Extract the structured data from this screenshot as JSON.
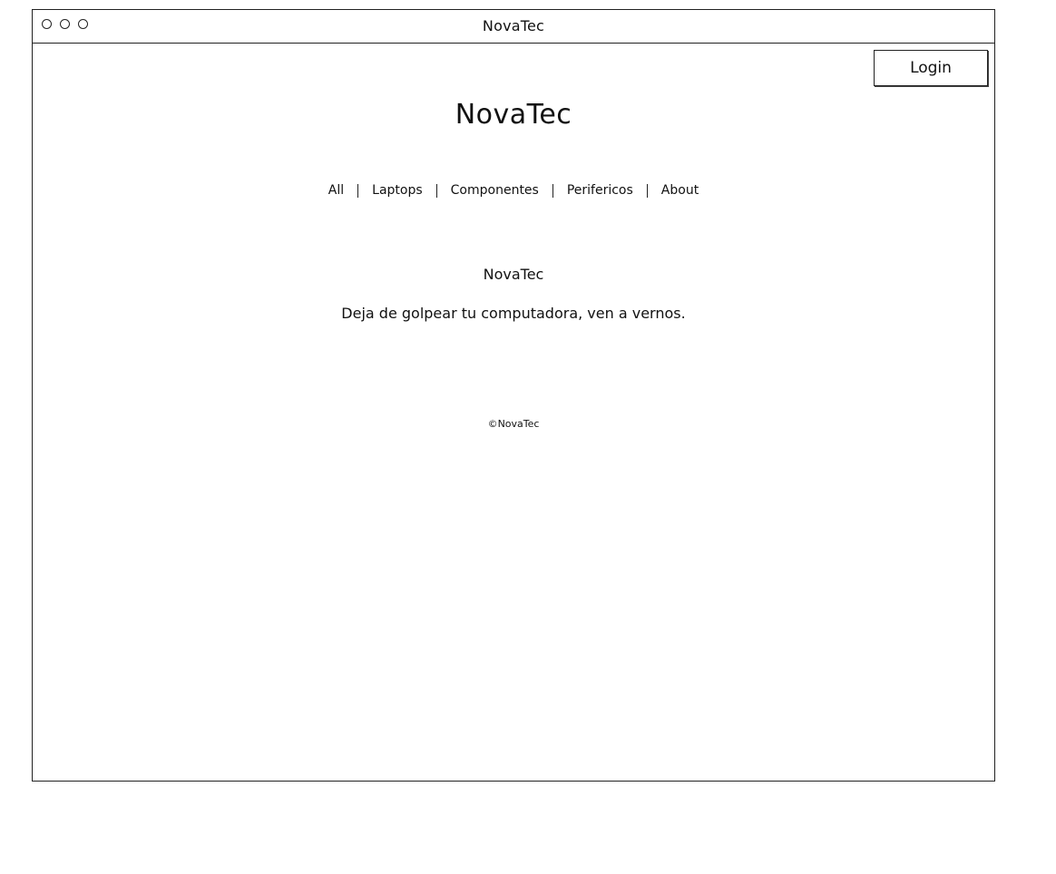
{
  "window": {
    "title": "NovaTec"
  },
  "header": {
    "login_label": "Login",
    "site_title": "NovaTec"
  },
  "nav": {
    "items": [
      {
        "label": "All"
      },
      {
        "label": "Laptops"
      },
      {
        "label": "Componentes"
      },
      {
        "label": "Perifericos"
      },
      {
        "label": "About"
      }
    ]
  },
  "hero": {
    "heading": "NovaTec",
    "tagline": "Deja de golpear tu computadora, ven a vernos."
  },
  "footer": {
    "copyright": "©NovaTec"
  }
}
